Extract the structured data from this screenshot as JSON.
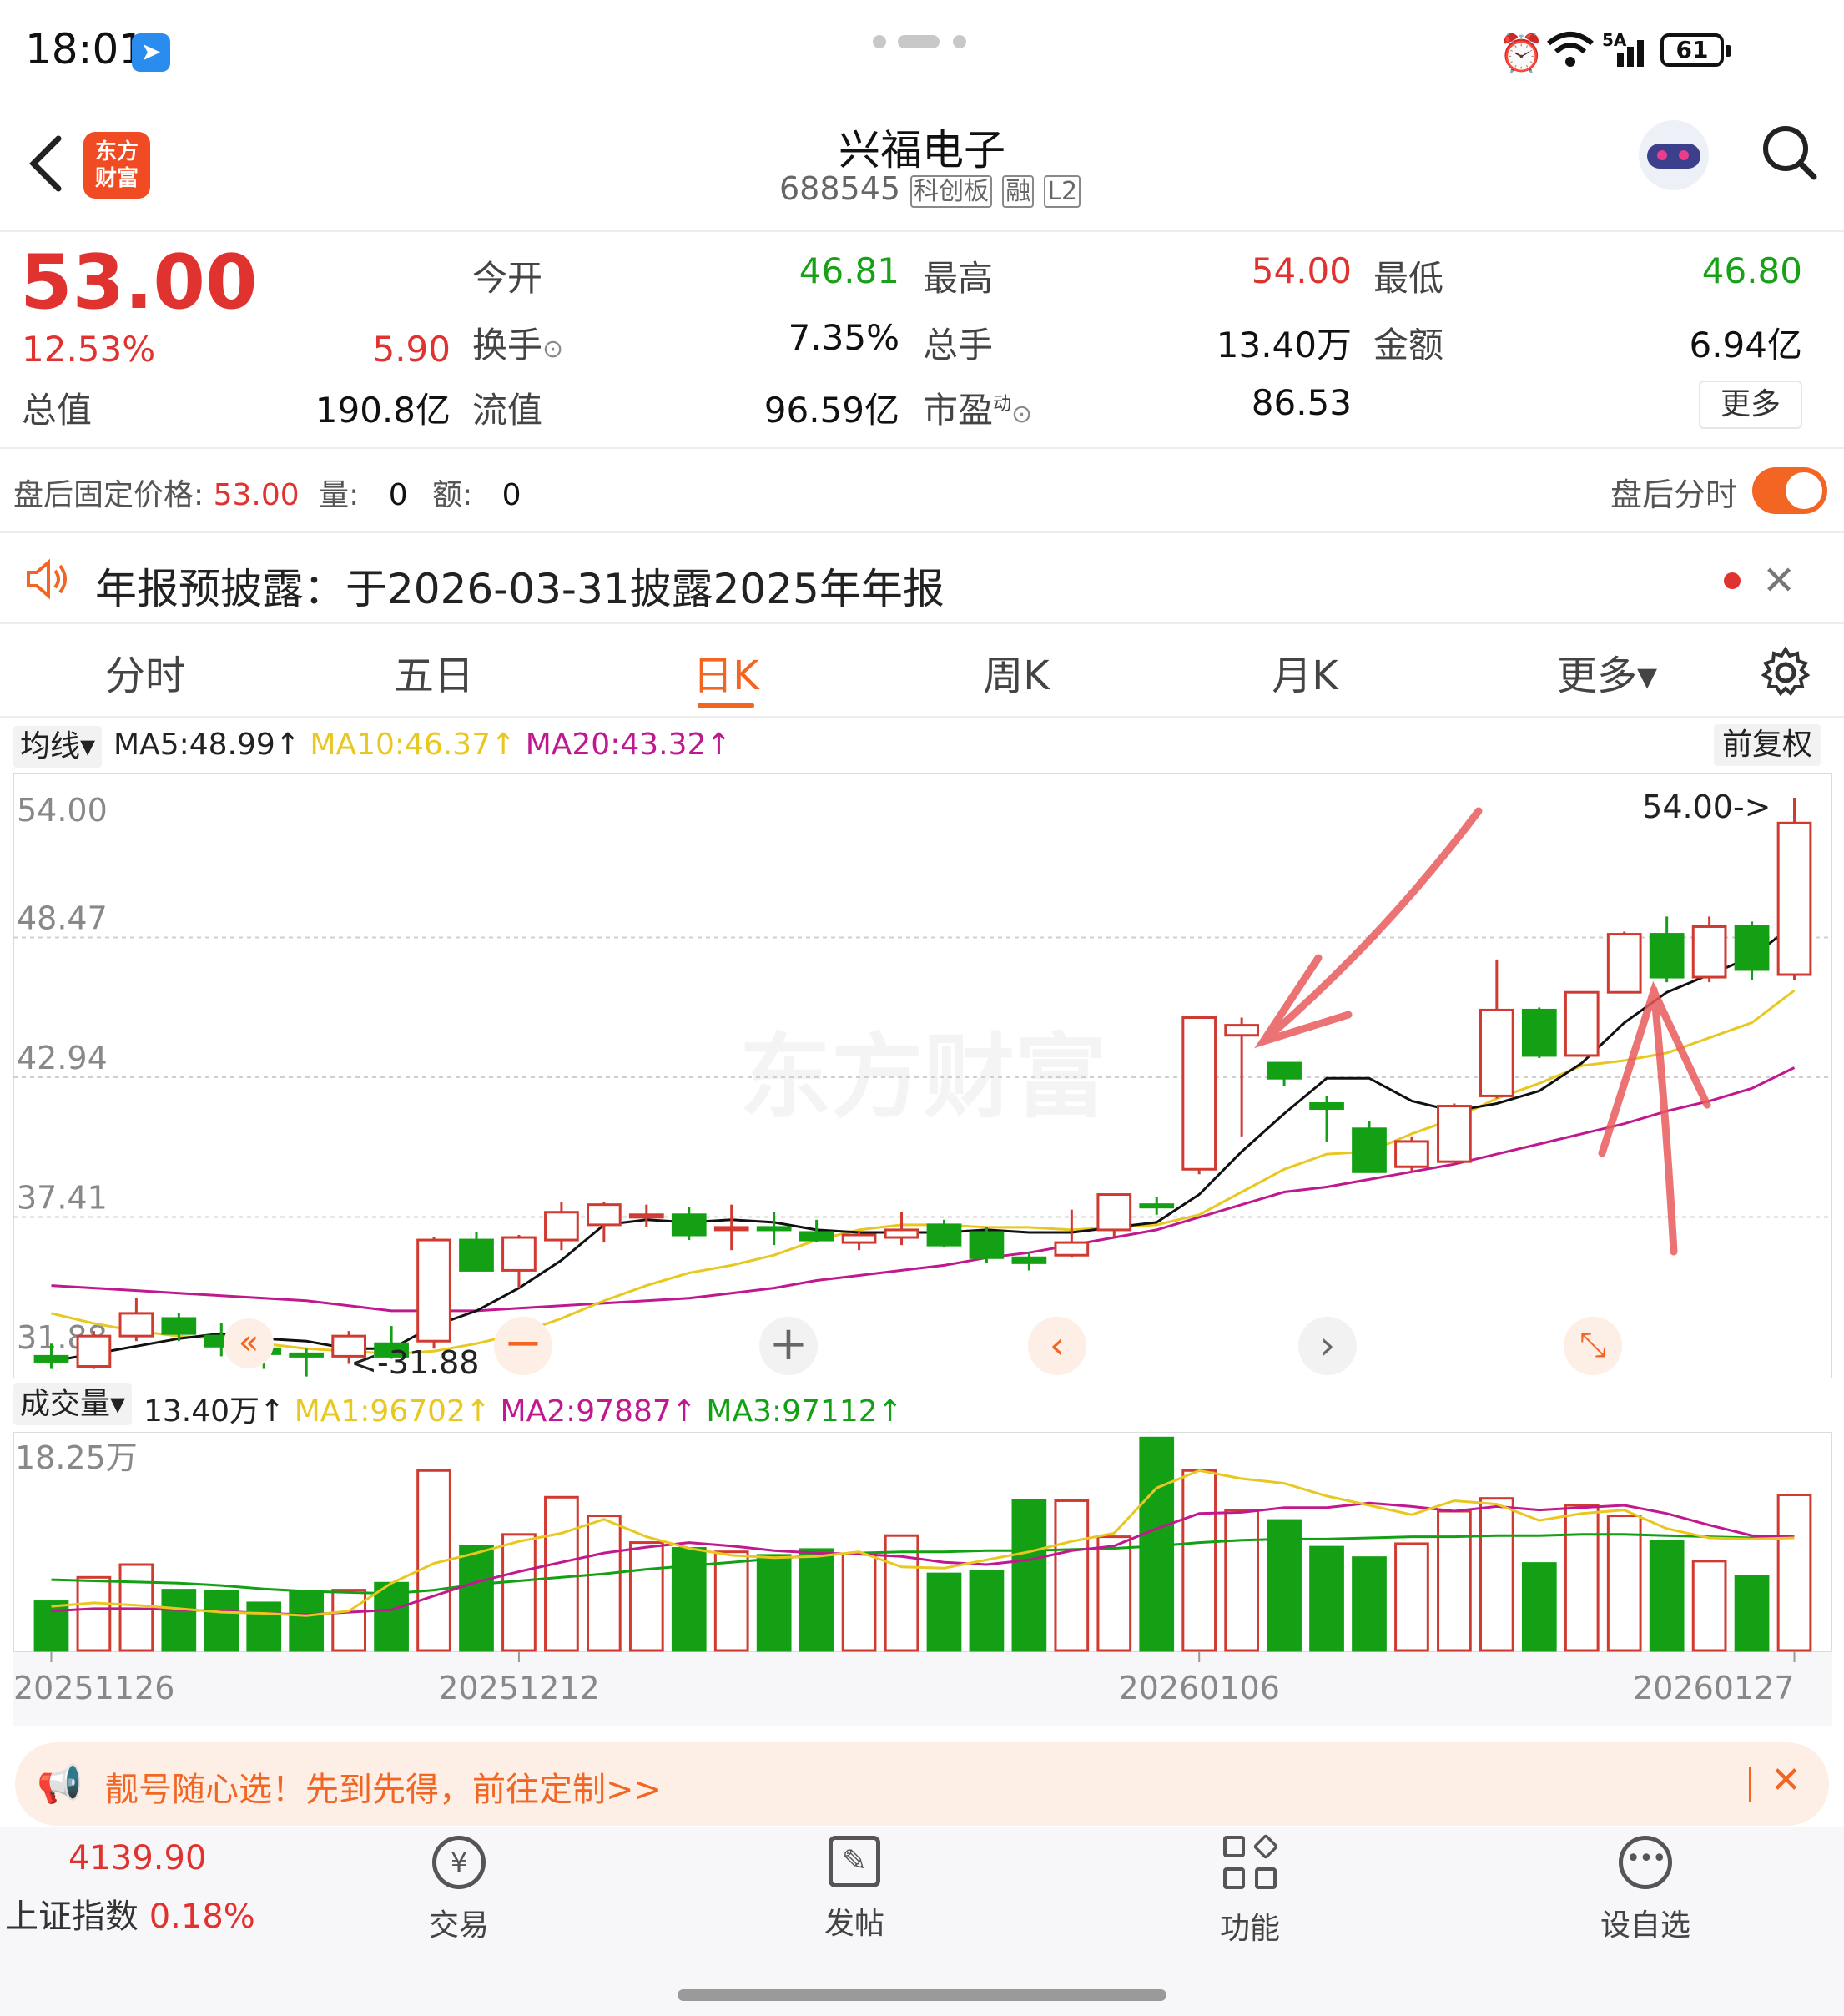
{
  "status_bar": {
    "time": "18:01",
    "battery": "61",
    "network": "5A"
  },
  "header": {
    "app_logo": "东方\n财富",
    "stock_name": "兴福电子",
    "stock_code": "688545",
    "badges": [
      "科创板",
      "融",
      "L2"
    ]
  },
  "quote": {
    "price": "53.00",
    "change_pct": "12.53%",
    "change_amt": "5.90",
    "total_value_label": "总值",
    "total_value": "190.8亿",
    "rows": [
      {
        "l1": "今开",
        "v1": "46.81",
        "l2": "最高",
        "v2": "54.00",
        "l3": "最低",
        "v3": "46.80"
      },
      {
        "l1": "换手",
        "v1": "7.35%",
        "l2": "总手",
        "v2": "13.40万",
        "l3": "金额",
        "v3": "6.94亿"
      },
      {
        "l1": "流值",
        "v1": "96.59亿",
        "l2": "市盈",
        "v2": "86.53",
        "l3": "",
        "v3": ""
      }
    ],
    "pe_sup": "动",
    "more_label": "更多"
  },
  "after_hours": {
    "label": "盘后固定价格:",
    "price": "53.00",
    "vol_label": "量:",
    "vol": "0",
    "amt_label": "额:",
    "amt": "0",
    "toggle_label": "盘后分时",
    "toggle_on": true
  },
  "notice": {
    "text": "年报预披露：于2026-03-31披露2025年年报"
  },
  "tabs": [
    "分时",
    "五日",
    "日K",
    "周K",
    "月K",
    "更多▾"
  ],
  "active_tab": "日K",
  "ma_bar": {
    "selector": "均线▾",
    "ma5": "MA5:48.99↑",
    "ma10": "MA10:46.37↑",
    "ma20": "MA20:43.32↑",
    "adj": "前复权"
  },
  "price_axis": [
    "54.00",
    "48.47",
    "42.94",
    "37.41",
    "31.88"
  ],
  "annotations": {
    "high_marker": "54.00->",
    "low_marker": "<-31.88",
    "watermark": "东方财富"
  },
  "vol_bar": {
    "selector": "成交量▾",
    "value": "13.40万↑",
    "ma1": "MA1:96702↑",
    "ma2": "MA2:97887↑",
    "ma3": "MA3:97112↑",
    "axis_max": "18.25万"
  },
  "dates": [
    "20251126",
    "20251212",
    "20260106",
    "20260127"
  ],
  "banner": {
    "text": "靓号随心选！先到先得，前往定制>>"
  },
  "bottom_nav": {
    "index_value": "4139.90",
    "index_name": "上证指数",
    "index_change": "0.18%",
    "items": [
      "交易",
      "发帖",
      "功能",
      "设自选"
    ]
  },
  "colors": {
    "up": "#d03a30",
    "down": "#14a014",
    "ma5": "#111111",
    "ma10": "#e8c820",
    "ma20": "#c0188f",
    "accent": "#f26522"
  },
  "chart_data": {
    "type": "candlestick",
    "ylim": [
      31.88,
      54.0
    ],
    "candles": [
      {
        "o": 31.9,
        "h": 32.4,
        "l": 31.4,
        "c": 31.7
      },
      {
        "o": 31.5,
        "h": 32.9,
        "l": 31.4,
        "c": 32.7
      },
      {
        "o": 32.7,
        "h": 34.2,
        "l": 32.5,
        "c": 33.6
      },
      {
        "o": 33.4,
        "h": 33.6,
        "l": 32.5,
        "c": 32.8
      },
      {
        "o": 32.7,
        "h": 33.2,
        "l": 31.9,
        "c": 32.3
      },
      {
        "o": 32.2,
        "h": 32.5,
        "l": 31.4,
        "c": 32.0
      },
      {
        "o": 32.0,
        "h": 32.2,
        "l": 31.1,
        "c": 31.9
      },
      {
        "o": 31.9,
        "h": 32.9,
        "l": 31.6,
        "c": 32.7
      },
      {
        "o": 32.4,
        "h": 33.1,
        "l": 31.8,
        "c": 31.9
      },
      {
        "o": 32.5,
        "h": 36.6,
        "l": 32.2,
        "c": 36.5
      },
      {
        "o": 36.5,
        "h": 36.8,
        "l": 35.3,
        "c": 35.3
      },
      {
        "o": 35.3,
        "h": 36.7,
        "l": 34.6,
        "c": 36.6
      },
      {
        "o": 36.5,
        "h": 38.0,
        "l": 36.1,
        "c": 37.6
      },
      {
        "o": 37.1,
        "h": 38.0,
        "l": 36.4,
        "c": 37.9
      },
      {
        "o": 37.4,
        "h": 37.9,
        "l": 37.0,
        "c": 37.5
      },
      {
        "o": 37.5,
        "h": 37.8,
        "l": 36.5,
        "c": 36.7
      },
      {
        "o": 37.0,
        "h": 37.9,
        "l": 36.1,
        "c": 37.0
      },
      {
        "o": 37.0,
        "h": 37.6,
        "l": 36.3,
        "c": 36.9
      },
      {
        "o": 36.8,
        "h": 37.3,
        "l": 36.4,
        "c": 36.5
      },
      {
        "o": 36.4,
        "h": 36.8,
        "l": 36.1,
        "c": 36.7
      },
      {
        "o": 36.6,
        "h": 37.6,
        "l": 36.3,
        "c": 36.9
      },
      {
        "o": 37.1,
        "h": 37.3,
        "l": 36.2,
        "c": 36.3
      },
      {
        "o": 36.8,
        "h": 37.0,
        "l": 35.6,
        "c": 35.8
      },
      {
        "o": 35.8,
        "h": 36.0,
        "l": 35.3,
        "c": 35.6
      },
      {
        "o": 35.9,
        "h": 37.7,
        "l": 35.8,
        "c": 36.4
      },
      {
        "o": 36.9,
        "h": 38.3,
        "l": 36.6,
        "c": 38.3
      },
      {
        "o": 37.9,
        "h": 38.2,
        "l": 37.5,
        "c": 37.8
      },
      {
        "o": 39.3,
        "h": 45.3,
        "l": 39.1,
        "c": 45.3
      },
      {
        "o": 44.6,
        "h": 45.3,
        "l": 40.6,
        "c": 45.0
      },
      {
        "o": 43.5,
        "h": 43.5,
        "l": 42.6,
        "c": 42.9
      },
      {
        "o": 41.9,
        "h": 42.2,
        "l": 40.4,
        "c": 41.7
      },
      {
        "o": 40.9,
        "h": 41.2,
        "l": 39.2,
        "c": 39.2
      },
      {
        "o": 39.4,
        "h": 40.6,
        "l": 39.2,
        "c": 40.4
      },
      {
        "o": 39.6,
        "h": 41.9,
        "l": 39.6,
        "c": 41.8
      },
      {
        "o": 42.2,
        "h": 47.6,
        "l": 42.1,
        "c": 45.6
      },
      {
        "o": 45.6,
        "h": 45.7,
        "l": 43.7,
        "c": 43.8
      },
      {
        "o": 43.8,
        "h": 46.3,
        "l": 43.8,
        "c": 46.3
      },
      {
        "o": 46.3,
        "h": 48.7,
        "l": 46.3,
        "c": 48.6
      },
      {
        "o": 48.6,
        "h": 49.3,
        "l": 46.7,
        "c": 46.9
      },
      {
        "o": 46.9,
        "h": 49.3,
        "l": 46.7,
        "c": 48.9
      },
      {
        "o": 48.9,
        "h": 49.1,
        "l": 46.8,
        "c": 47.2
      },
      {
        "o": 47.0,
        "h": 54.0,
        "l": 46.8,
        "c": 53.0
      }
    ],
    "ma5": [
      31.7,
      32.0,
      32.3,
      32.6,
      32.8,
      32.6,
      32.5,
      32.2,
      32.2,
      33.1,
      33.7,
      34.6,
      35.7,
      37.1,
      37.3,
      37.2,
      37.3,
      37.2,
      36.9,
      36.8,
      36.8,
      36.8,
      36.9,
      36.8,
      36.8,
      37.0,
      37.2,
      38.3,
      40.0,
      41.5,
      42.9,
      42.9,
      42.0,
      41.6,
      41.9,
      42.4,
      43.5,
      45.1,
      46.3,
      47.0,
      47.7,
      48.99
    ],
    "ma10": [
      33.6,
      33.2,
      32.9,
      32.7,
      32.6,
      32.4,
      32.2,
      32.1,
      32.0,
      32.1,
      32.4,
      32.8,
      33.4,
      34.1,
      34.7,
      35.2,
      35.5,
      35.9,
      36.5,
      36.9,
      37.1,
      37.1,
      37.0,
      37.0,
      36.9,
      37.0,
      37.1,
      37.5,
      38.4,
      39.3,
      39.9,
      40.0,
      40.7,
      41.3,
      42.1,
      42.7,
      43.4,
      43.6,
      43.9,
      44.5,
      45.1,
      46.37
    ],
    "ma20": [
      34.7,
      34.6,
      34.5,
      34.4,
      34.3,
      34.2,
      34.1,
      33.9,
      33.7,
      33.7,
      33.7,
      33.8,
      33.9,
      34.0,
      34.1,
      34.2,
      34.4,
      34.6,
      34.9,
      35.1,
      35.3,
      35.5,
      35.8,
      36.0,
      36.3,
      36.6,
      36.9,
      37.4,
      37.9,
      38.4,
      38.6,
      38.9,
      39.2,
      39.5,
      39.9,
      40.3,
      40.7,
      41.1,
      41.6,
      42.0,
      42.5,
      43.32
    ],
    "volume": [
      4.2,
      6.3,
      7.4,
      5.2,
      5.1,
      4.1,
      5.0,
      5.2,
      5.8,
      15.5,
      9.0,
      10.0,
      13.2,
      11.6,
      9.3,
      8.8,
      8.5,
      8.2,
      8.7,
      8.3,
      9.9,
      6.6,
      6.8,
      12.9,
      12.9,
      9.8,
      18.3,
      15.5,
      12.1,
      11.2,
      8.9,
      8.0,
      9.2,
      12.0,
      13.1,
      7.5,
      12.5,
      11.6,
      9.4,
      7.7,
      6.4,
      13.4
    ],
    "vol_ma1": [
      3.8,
      4.1,
      3.9,
      3.6,
      3.3,
      3.2,
      3.0,
      3.4,
      5.8,
      7.5,
      8.4,
      9.4,
      10.1,
      11.3,
      9.8,
      8.8,
      8.2,
      8.0,
      8.1,
      8.5,
      7.2,
      7.1,
      7.8,
      8.5,
      9.4,
      10.1,
      14.0,
      15.5,
      14.8,
      14.4,
      13.3,
      12.5,
      11.7,
      12.9,
      12.6,
      11.2,
      11.8,
      12.1,
      10.5,
      9.7,
      9.6,
      9.7
    ],
    "vol_ma2": [
      3.4,
      3.6,
      3.6,
      3.5,
      3.4,
      3.2,
      3.1,
      3.3,
      3.5,
      4.7,
      5.9,
      6.8,
      7.6,
      8.4,
      8.9,
      9.3,
      9.0,
      8.6,
      8.4,
      8.3,
      8.1,
      7.6,
      7.4,
      7.8,
      8.6,
      9.0,
      10.5,
      11.8,
      11.9,
      12.3,
      12.3,
      12.7,
      12.4,
      12.0,
      12.4,
      12.1,
      12.3,
      12.5,
      11.8,
      10.8,
      9.9,
      9.8
    ],
    "vol_ma3": [
      6.1,
      6.0,
      5.9,
      5.8,
      5.6,
      5.3,
      5.1,
      5.0,
      4.9,
      5.2,
      5.7,
      6.0,
      6.3,
      6.6,
      7.0,
      7.3,
      7.6,
      7.9,
      8.2,
      8.4,
      8.5,
      8.5,
      8.6,
      8.6,
      8.7,
      8.8,
      9.0,
      9.3,
      9.5,
      9.6,
      9.6,
      9.7,
      9.8,
      9.8,
      9.9,
      9.9,
      10.0,
      10.0,
      9.9,
      9.8,
      9.7,
      9.7
    ],
    "vol_ylim": [
      0,
      18.25
    ]
  }
}
